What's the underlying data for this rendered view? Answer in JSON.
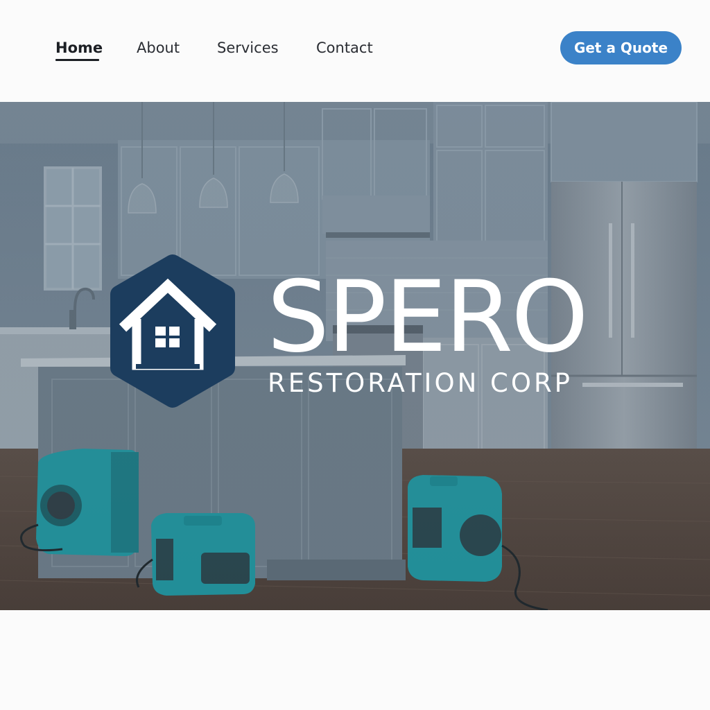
{
  "nav": {
    "links": [
      {
        "label": "Home",
        "active": true
      },
      {
        "label": "About",
        "active": false
      },
      {
        "label": "Services",
        "active": false
      },
      {
        "label": "Contact",
        "active": false
      }
    ],
    "cta_label": "Get a Quote"
  },
  "hero": {
    "background_image": "kitchen interior with teal water-restoration air movers on hardwood floor",
    "logo": {
      "icon": "house-in-hexagon-icon",
      "name": "SPERO",
      "tagline": "RESTORATION CORP"
    }
  },
  "colors": {
    "accent": "#3b82c8",
    "logo_navy": "#1c3d5e",
    "text_dark": "#1c1f24",
    "air_mover_teal": "#1d9aa4"
  }
}
